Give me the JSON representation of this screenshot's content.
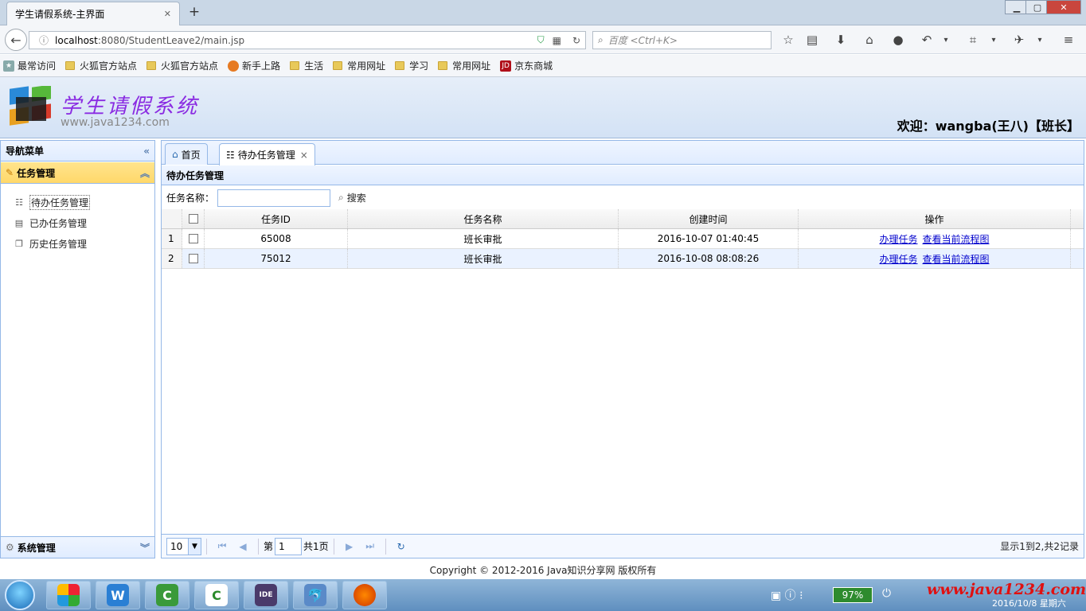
{
  "browser": {
    "tab_title": "学生请假系统-主界面",
    "tab_close": "✕",
    "new_tab": "+",
    "url_host": "localhost",
    "url_rest": ":8080/StudentLeave2/main.jsp",
    "search_placeholder": "百度 <Ctrl+K>",
    "bookmarks": [
      "最常访问",
      "火狐官方站点",
      "火狐官方站点",
      "新手上路",
      "生活",
      "常用网址",
      "学习",
      "常用网址",
      "京东商城"
    ]
  },
  "header": {
    "logo_title": "学生请假系统",
    "logo_url": "www.java1234.com",
    "welcome": "欢迎：wangba(王八)【班长】"
  },
  "leftnav": {
    "title": "导航菜单",
    "task_section": "任务管理",
    "items": [
      "待办任务管理",
      "已办任务管理",
      "历史任务管理"
    ],
    "sys_section": "系统管理"
  },
  "main": {
    "tabs": [
      "首页",
      "待办任务管理"
    ],
    "tab_close": "×",
    "panel_title": "待办任务管理",
    "search_label": "任务名称：",
    "search_button": "搜索",
    "columns": [
      "任务ID",
      "任务名称",
      "创建时间",
      "操作"
    ],
    "rows": [
      {
        "num": "1",
        "id": "65008",
        "name": "班长审批",
        "time": "2016-10-07 01:40:45",
        "op1": "办理任务",
        "op2": "查看当前流程图"
      },
      {
        "num": "2",
        "id": "75012",
        "name": "班长审批",
        "time": "2016-10-08 08:08:26",
        "op1": "办理任务",
        "op2": "查看当前流程图"
      }
    ],
    "pager": {
      "page_size": "10",
      "page_prefix": "第",
      "page_value": "1",
      "page_total": "共1页",
      "records": "显示1到2,共2记录"
    }
  },
  "footer": {
    "copyright": "Copyright © 2012-2016 Java知识分享网 版权所有"
  },
  "taskbar": {
    "battery": "97%",
    "watermark": "www.java1234.com",
    "clock": "2016/10/8 星期六"
  }
}
